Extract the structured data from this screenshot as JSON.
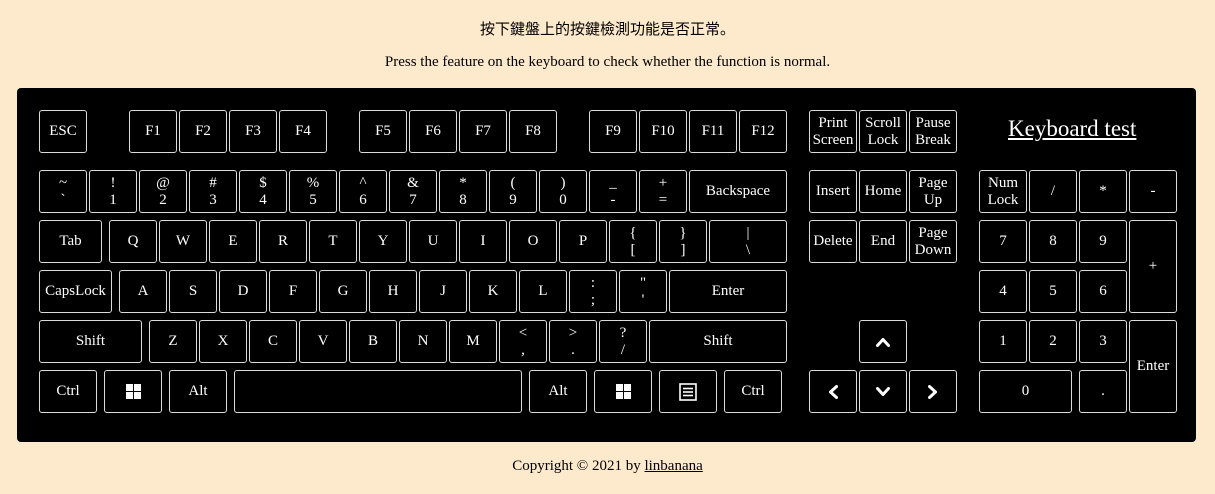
{
  "header": {
    "instruction_zh": "按下鍵盤上的按鍵檢測功能是否正常。",
    "instruction_en": "Press the feature on the keyboard to check whether the function is normal."
  },
  "keyboard": {
    "title": "Keyboard test",
    "keys": {
      "esc": "ESC",
      "f1": "F1",
      "f2": "F2",
      "f3": "F3",
      "f4": "F4",
      "f5": "F5",
      "f6": "F6",
      "f7": "F7",
      "f8": "F8",
      "f9": "F9",
      "f10": "F10",
      "f11": "F11",
      "f12": "F12",
      "print_top": "Print",
      "print_bottom": "Screen",
      "scroll_top": "Scroll",
      "scroll_bottom": "Lock",
      "pause_top": "Pause",
      "pause_bottom": "Break",
      "tilde_top": "~",
      "tilde_bottom": "`",
      "d1_top": "!",
      "d1_bottom": "1",
      "d2_top": "@",
      "d2_bottom": "2",
      "d3_top": "#",
      "d3_bottom": "3",
      "d4_top": "$",
      "d4_bottom": "4",
      "d5_top": "%",
      "d5_bottom": "5",
      "d6_top": "^",
      "d6_bottom": "6",
      "d7_top": "&",
      "d7_bottom": "7",
      "d8_top": "*",
      "d8_bottom": "8",
      "d9_top": "(",
      "d9_bottom": "9",
      "d0_top": ")",
      "d0_bottom": "0",
      "minus_top": "_",
      "minus_bottom": "-",
      "equal_top": "+",
      "equal_bottom": "=",
      "backspace": "Backspace",
      "insert": "Insert",
      "home": "Home",
      "pageup_top": "Page",
      "pageup_bottom": "Up",
      "numlock_top": "Num",
      "numlock_bottom": "Lock",
      "np_slash": "/",
      "np_star": "*",
      "np_minus": "-",
      "tab": "Tab",
      "q": "Q",
      "w": "W",
      "e": "E",
      "r": "R",
      "t": "T",
      "y": "Y",
      "u": "U",
      "i": "I",
      "o": "O",
      "p": "P",
      "lbracket_top": "{",
      "lbracket_bottom": "[",
      "rbracket_top": "}",
      "rbracket_bottom": "]",
      "backslash_top": "|",
      "backslash_bottom": "\\",
      "delete": "Delete",
      "end": "End",
      "pagedown_top": "Page",
      "pagedown_bottom": "Down",
      "np7": "7",
      "np8": "8",
      "np9": "9",
      "np_plus": "+",
      "capslock": "CapsLock",
      "a": "A",
      "s": "S",
      "d": "D",
      "f": "F",
      "g": "G",
      "h": "H",
      "j": "J",
      "k": "K",
      "l": "L",
      "semicolon_top": ":",
      "semicolon_bottom": ";",
      "quote_top": "\"",
      "quote_bottom": "'",
      "enter": "Enter",
      "np4": "4",
      "np5": "5",
      "np6": "6",
      "shift_left": "Shift",
      "z": "Z",
      "x": "X",
      "c": "C",
      "v": "V",
      "b": "B",
      "n": "N",
      "m": "M",
      "comma_top": "<",
      "comma_bottom": ",",
      "period_top": ">",
      "period_bottom": ".",
      "slash_top": "?",
      "slash_bottom": "/",
      "shift_right": "Shift",
      "np1": "1",
      "np2": "2",
      "np3": "3",
      "np_enter": "Enter",
      "ctrl_left": "Ctrl",
      "alt_left": "Alt",
      "alt_right": "Alt",
      "ctrl_right": "Ctrl",
      "np0": "0",
      "np_dot": "."
    }
  },
  "footer": {
    "copyright": "Copyright © 2021 by",
    "author": "linbanana"
  }
}
